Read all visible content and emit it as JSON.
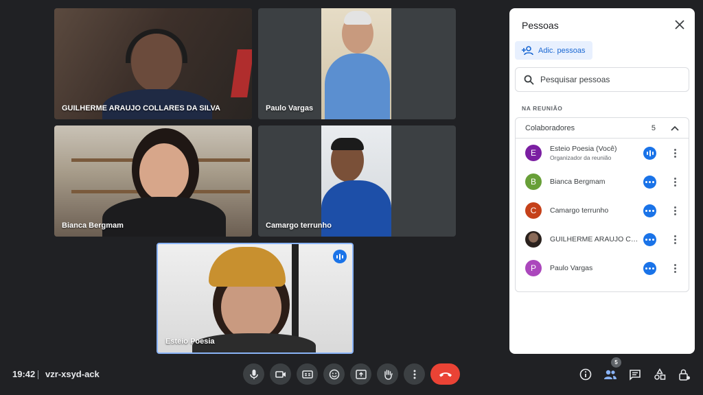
{
  "participants_tiles": [
    {
      "name": "GUILHERME ARAUJO COLLARES DA SILVA"
    },
    {
      "name": "Paulo Vargas"
    },
    {
      "name": "Bianca Bergmam"
    },
    {
      "name": "Camargo terrunho"
    },
    {
      "name": "Esteio Poesia",
      "speaking": true
    }
  ],
  "panel": {
    "title": "Pessoas",
    "add_label": "Adic. pessoas",
    "search_placeholder": "Pesquisar pessoas",
    "section_label": "NA REUNIÃO",
    "group": {
      "label": "Colaboradores",
      "count": "5"
    },
    "people": [
      {
        "initial": "E",
        "name": "Esteio Poesia (Você)",
        "role": "Organizador da reunião",
        "color": "#7b1fa2",
        "status": "speaking"
      },
      {
        "initial": "B",
        "name": "Bianca Bergmam",
        "role": "",
        "color": "#689f38",
        "status": "more"
      },
      {
        "initial": "C",
        "name": "Camargo terrunho",
        "role": "",
        "color": "#c5411a",
        "status": "more"
      },
      {
        "initial": "",
        "name": "GUILHERME ARAUJO CO...",
        "role": "",
        "color": "#3a2f2a",
        "status": "more"
      },
      {
        "initial": "P",
        "name": "Paulo Vargas",
        "role": "",
        "color": "#ab47bc",
        "status": "more"
      }
    ]
  },
  "bottom_bar": {
    "time": "19:42",
    "meeting_code": "vzr-xsyd-ack",
    "people_count": "5",
    "icons": [
      "mic-icon",
      "camera-icon",
      "captions-icon",
      "emoji-icon",
      "present-icon",
      "raise-hand-icon",
      "more-options-icon",
      "end-call-icon",
      "info-icon",
      "people-icon",
      "chat-icon",
      "activities-icon",
      "host-controls-icon"
    ]
  },
  "colors": {
    "background": "#202124",
    "tile": "#3c4043",
    "accent": "#1a73e8",
    "end_call": "#ea4335"
  }
}
